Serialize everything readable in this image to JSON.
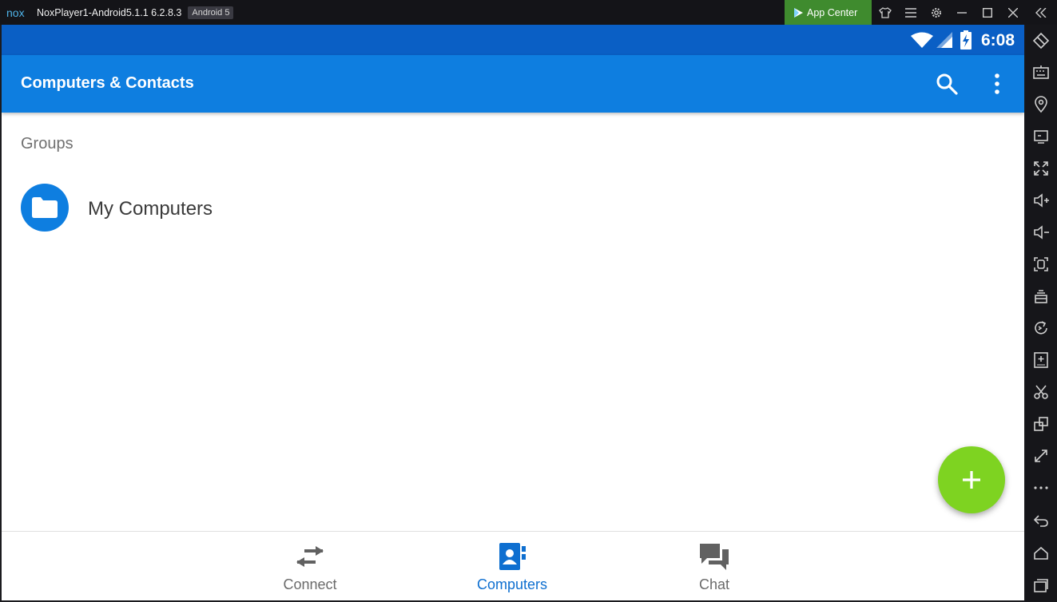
{
  "window": {
    "logo_text": "nox",
    "title": "NoxPlayer1-Android5.1.1 6.2.8.3",
    "android_badge": "Android 5",
    "app_center_label": "App Center"
  },
  "status_bar": {
    "time": "6:08"
  },
  "app_bar": {
    "title": "Computers & Contacts"
  },
  "content": {
    "section_label": "Groups",
    "groups": [
      {
        "name": "My Computers",
        "icon": "folder-icon"
      }
    ]
  },
  "bottom_nav": [
    {
      "label": "Connect",
      "icon": "swap-arrows-icon",
      "active": false
    },
    {
      "label": "Computers",
      "icon": "contacts-book-icon",
      "active": true
    },
    {
      "label": "Chat",
      "icon": "chat-bubbles-icon",
      "active": false
    }
  ],
  "colors": {
    "primary": "#0e7ee0",
    "status_bar": "#0a5fc5",
    "fab": "#7ed321",
    "app_center": "#3f8b2e",
    "active_nav": "#0e6fd0"
  }
}
